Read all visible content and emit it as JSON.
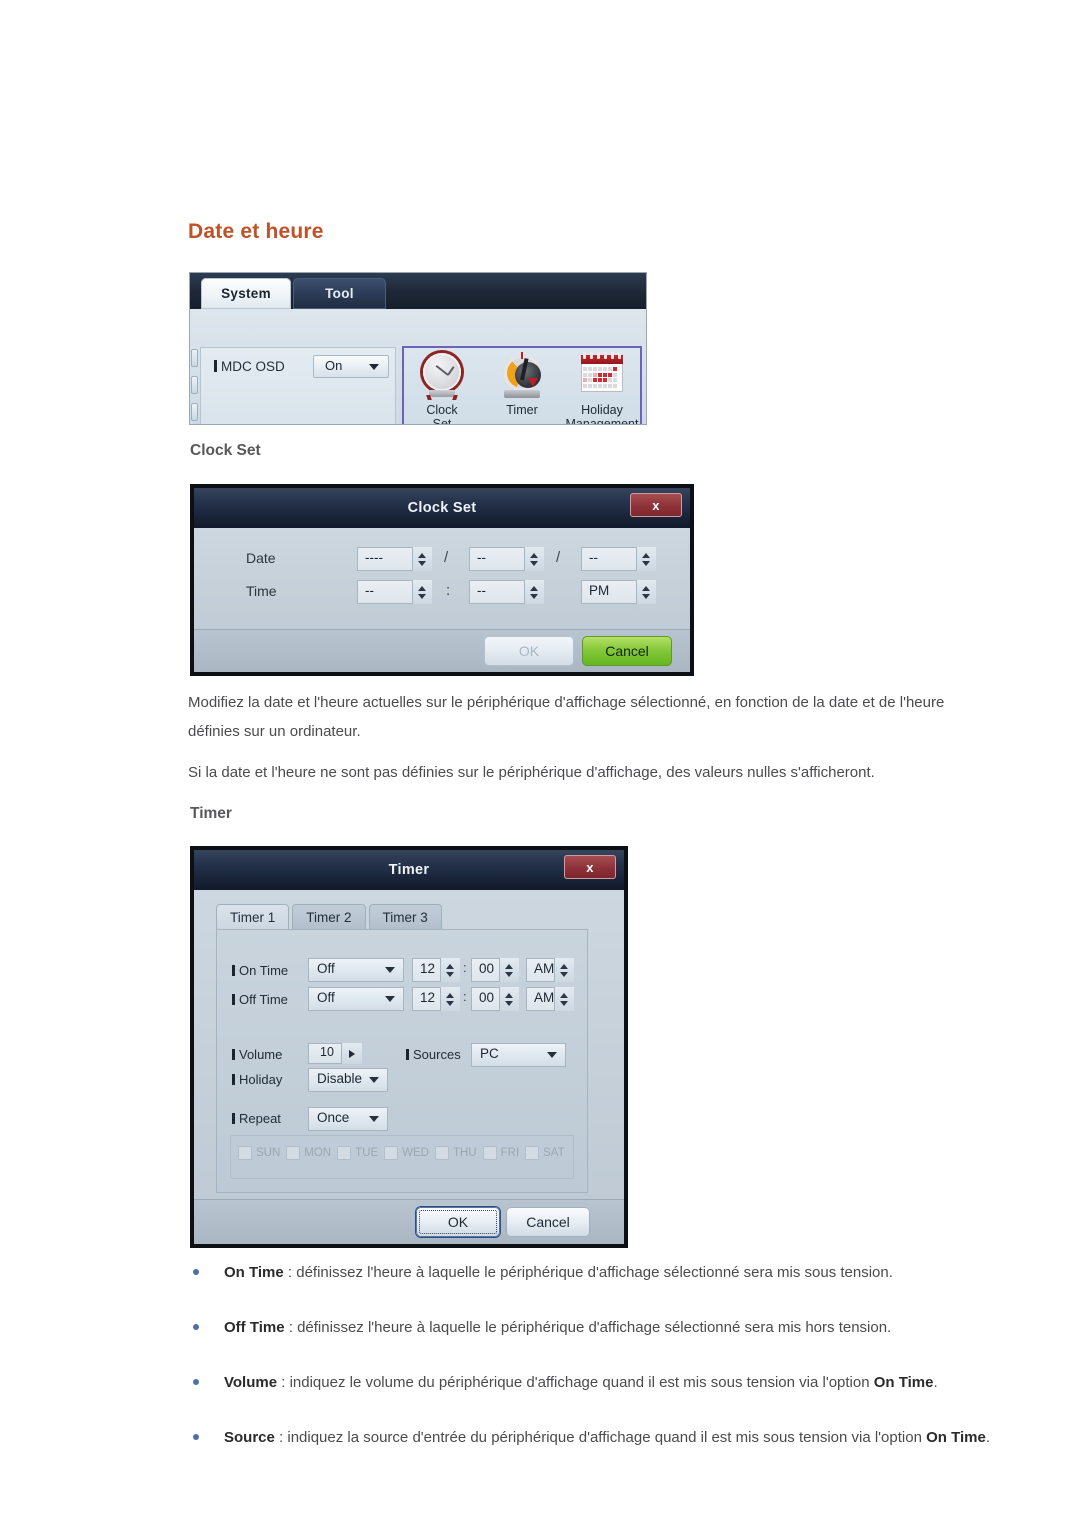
{
  "page": {
    "heading": "Date et heure",
    "subheadings": {
      "clock_set": "Clock Set",
      "timer": "Timer"
    },
    "paragraphs": {
      "p1": "Modifiez la date et l'heure actuelles sur le périphérique d'affichage sélectionné, en fonction de la date et de l'heure définies sur un ordinateur.",
      "p2": "Si la date et l'heure ne sont pas définies sur le périphérique d'affichage, des valeurs nulles s'afficheront."
    },
    "heading_color": "#c0522a"
  },
  "system_panel": {
    "tabs": [
      {
        "label": "System",
        "active": true
      },
      {
        "label": "Tool",
        "active": false
      }
    ],
    "mdc_osd": {
      "label": "MDC OSD",
      "value": "On"
    },
    "icon_group_highlight_color": "#6a63b8",
    "icons": [
      {
        "name": "clock-set-icon",
        "caption_line1": "Clock",
        "caption_line2": "Set"
      },
      {
        "name": "timer-icon",
        "caption_line1": "Timer",
        "caption_line2": ""
      },
      {
        "name": "holiday-management-icon",
        "caption_line1": "Holiday",
        "caption_line2": "Management"
      }
    ]
  },
  "clock_set_dialog": {
    "title": "Clock Set",
    "close_label": "x",
    "rows": [
      {
        "label": "Date",
        "fields": [
          {
            "value": "----"
          },
          {
            "value": "--"
          },
          {
            "value": "--"
          }
        ],
        "separators": [
          "/",
          "/"
        ]
      },
      {
        "label": "Time",
        "fields": [
          {
            "value": "--"
          },
          {
            "value": "--"
          },
          {
            "value": "PM"
          }
        ],
        "separators": [
          ":",
          ""
        ]
      }
    ],
    "buttons": {
      "ok": {
        "label": "OK",
        "state": "disabled"
      },
      "cancel": {
        "label": "Cancel",
        "state": "highlighted",
        "color": "#7ec337"
      }
    }
  },
  "timer_dialog": {
    "title": "Timer",
    "close_label": "x",
    "tabs": [
      {
        "label": "Timer 1",
        "active": true
      },
      {
        "label": "Timer 2",
        "active": false
      },
      {
        "label": "Timer 3",
        "active": false
      }
    ],
    "fields": {
      "on_time": {
        "label": "On Time",
        "mode": "Off",
        "hour": "12",
        "minute": "00",
        "meridiem": "AM"
      },
      "off_time": {
        "label": "Off Time",
        "mode": "Off",
        "hour": "12",
        "minute": "00",
        "meridiem": "AM"
      },
      "volume": {
        "label": "Volume",
        "value": "10"
      },
      "sources": {
        "label": "Sources",
        "value": "PC"
      },
      "holiday": {
        "label": "Holiday",
        "value": "Disable"
      },
      "repeat": {
        "label": "Repeat",
        "value": "Once"
      }
    },
    "weekdays": [
      {
        "label": "SUN",
        "checked": false
      },
      {
        "label": "MON",
        "checked": false
      },
      {
        "label": "TUE",
        "checked": false
      },
      {
        "label": "WED",
        "checked": false
      },
      {
        "label": "THU",
        "checked": false
      },
      {
        "label": "FRI",
        "checked": false
      },
      {
        "label": "SAT",
        "checked": false
      }
    ],
    "buttons": {
      "ok": {
        "label": "OK",
        "state": "focused"
      },
      "cancel": {
        "label": "Cancel",
        "state": "normal"
      }
    },
    "time_separator": ":"
  },
  "bullets": [
    {
      "term": "On Time",
      "rest": " : définissez l'heure à laquelle le périphérique d'affichage sélectionné sera mis sous tension."
    },
    {
      "term": "Off Time",
      "rest": " : définissez l'heure à laquelle le périphérique d'affichage sélectionné sera mis hors tension."
    },
    {
      "term": "Volume",
      "rest": " : indiquez le volume du périphérique d'affichage quand il est mis sous tension via l'option ",
      "term2": "On Time",
      "rest2": "."
    },
    {
      "term": "Source",
      "rest": " : indiquez la source d'entrée du périphérique d'affichage quand il est mis sous tension via l'option ",
      "term2": "On Time",
      "rest2": "."
    }
  ]
}
